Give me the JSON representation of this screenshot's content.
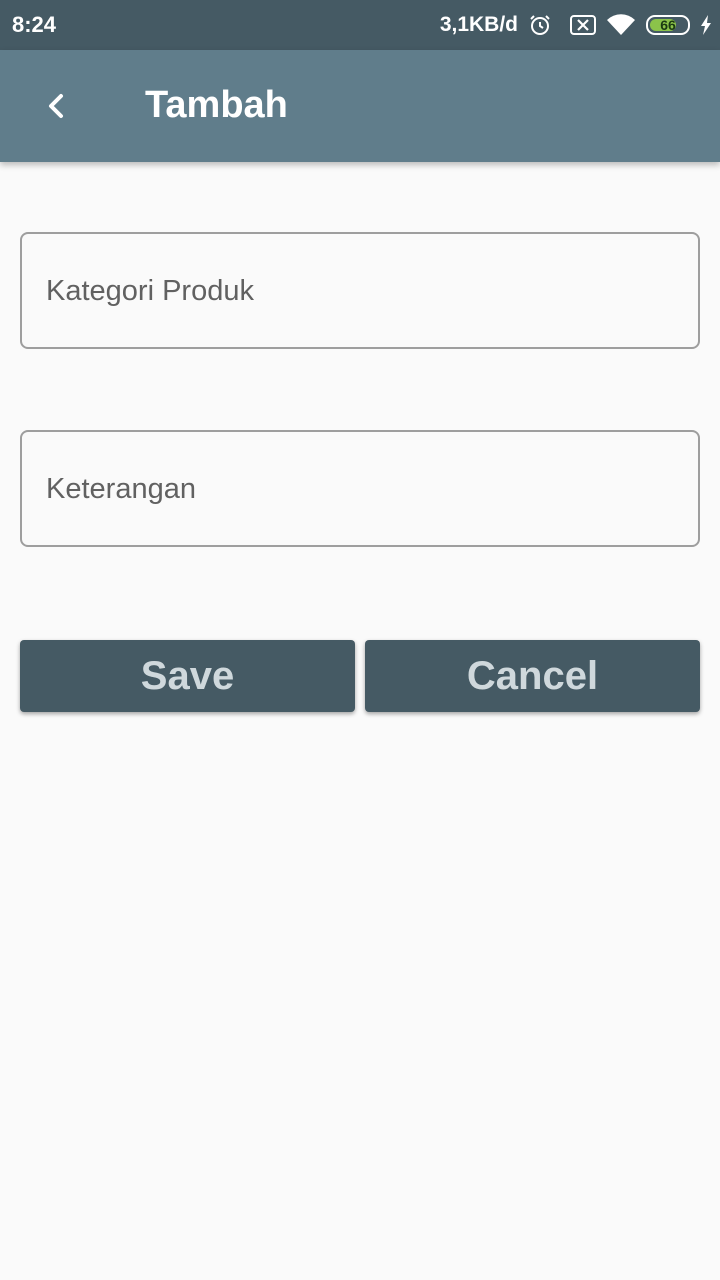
{
  "status_bar": {
    "time": "8:24",
    "network_speed": "3,1KB/d",
    "battery_level": "66",
    "icons": [
      "alarm-icon",
      "sim-x-icon",
      "wifi-icon",
      "battery-icon",
      "charging-bolt-icon"
    ]
  },
  "appbar": {
    "title": "Tambah",
    "back_icon": "chevron-left-icon"
  },
  "form": {
    "category_placeholder": "Kategori Produk",
    "category_value": "",
    "description_placeholder": "Keterangan",
    "description_value": ""
  },
  "actions": {
    "save_label": "Save",
    "cancel_label": "Cancel"
  },
  "colors": {
    "status_bar": "#455a64",
    "app_bar": "#607d8b",
    "button_bg": "#455a64",
    "button_text": "#cfd8dc",
    "background": "#fafafa"
  }
}
